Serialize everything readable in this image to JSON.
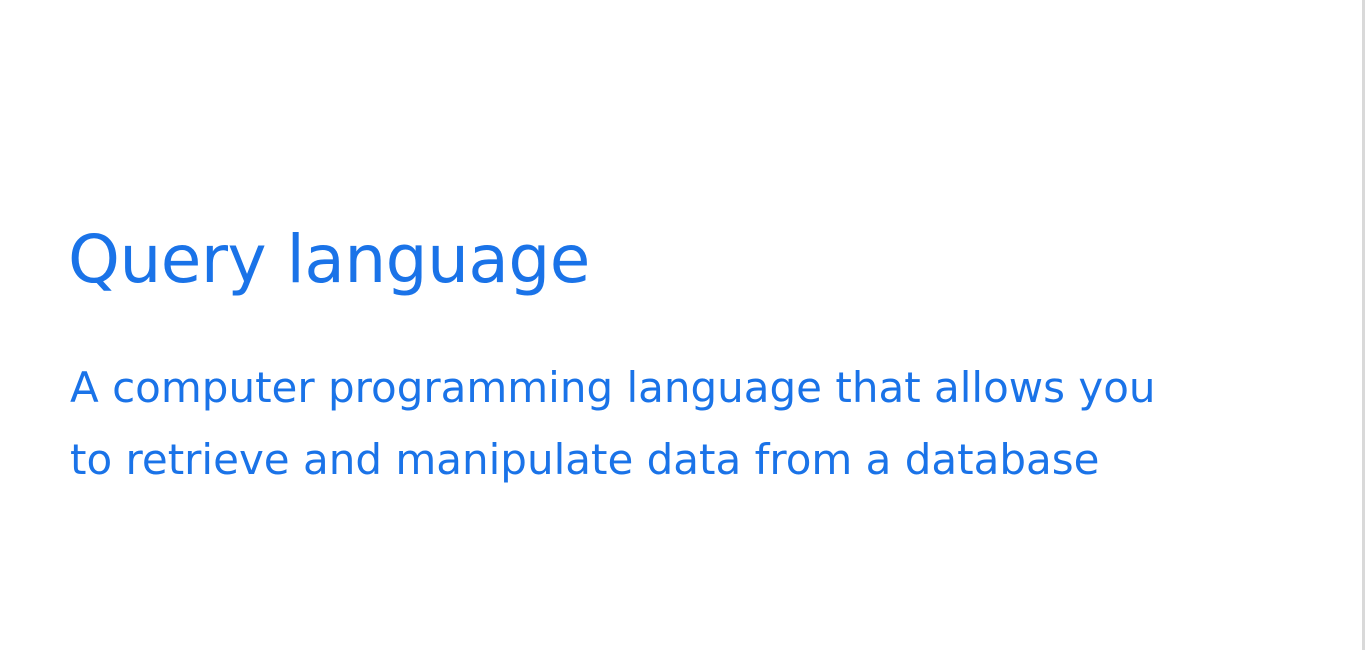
{
  "slide": {
    "title": "Query language",
    "definition_lines": [
      "A computer programming language that allows you",
      "to retrieve and manipulate data from a database"
    ]
  },
  "colors": {
    "text_accent": "#1a73e8",
    "background": "#ffffff",
    "edge": "#d9d9d9"
  }
}
